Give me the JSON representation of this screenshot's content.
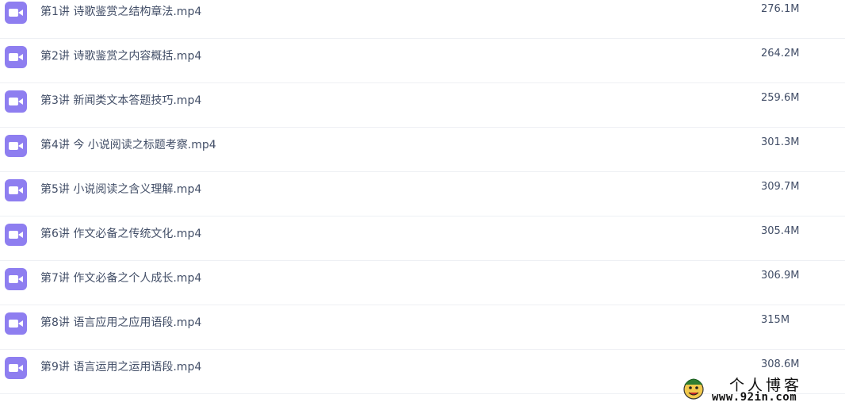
{
  "files": [
    {
      "name": "第1讲 诗歌鉴赏之结构章法.mp4",
      "size": "276.1M",
      "icon": "video-file-icon"
    },
    {
      "name": "第2讲 诗歌鉴赏之内容概括.mp4",
      "size": "264.2M",
      "icon": "video-file-icon"
    },
    {
      "name": "第3讲 新闻类文本答题技巧.mp4",
      "size": "259.6M",
      "icon": "video-file-icon"
    },
    {
      "name": "第4讲 今 小说阅读之标题考察.mp4",
      "size": "301.3M",
      "icon": "video-file-icon"
    },
    {
      "name": "第5讲 小说阅读之含义理解.mp4",
      "size": "309.7M",
      "icon": "video-file-icon"
    },
    {
      "name": "第6讲 作文必备之传统文化.mp4",
      "size": "305.4M",
      "icon": "video-file-icon"
    },
    {
      "name": "第7讲 作文必备之个人成长.mp4",
      "size": "306.9M",
      "icon": "video-file-icon"
    },
    {
      "name": "第8讲 语言应用之应用语段.mp4",
      "size": "315M",
      "icon": "video-file-icon"
    },
    {
      "name": "第9讲 语言运用之运用语段.mp4",
      "size": "308.6M",
      "icon": "video-file-icon"
    }
  ],
  "watermark": {
    "title": "个人博客",
    "url": "www.92in.com"
  },
  "colors": {
    "icon_bg": "#8e7ef0",
    "text": "#424e67",
    "divider": "#eef0f4"
  }
}
